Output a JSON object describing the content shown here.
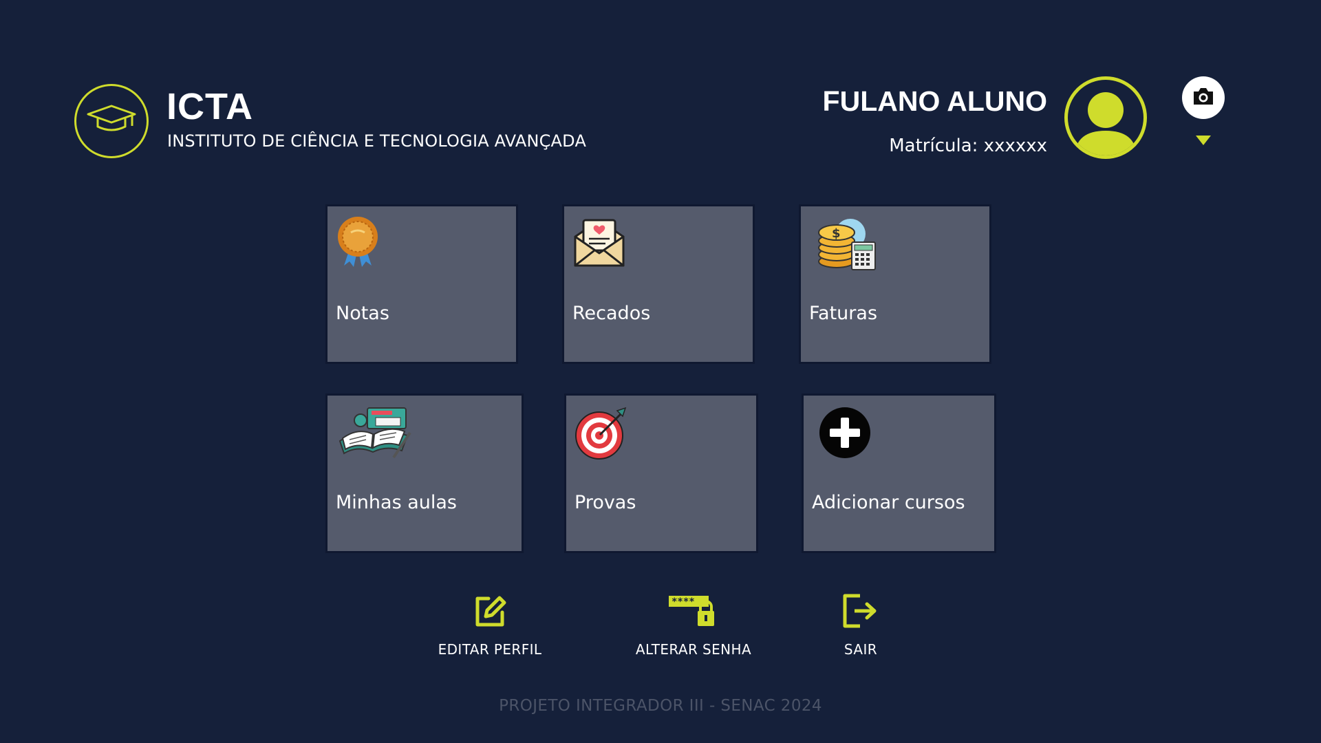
{
  "brand": {
    "title": "ICTA",
    "subtitle": "INSTITUTO DE CIÊNCIA E TECNOLOGIA AVANÇADA",
    "logo_icon": "graduation-cap-icon"
  },
  "user": {
    "name": "FULANO ALUNO",
    "matricula": "Matrícula: xxxxxx",
    "avatar_icon": "user-avatar-icon",
    "camera_icon": "camera-icon",
    "menu_icon": "chevron-down-icon"
  },
  "tiles": [
    {
      "label": "Notas",
      "icon": "medal-icon"
    },
    {
      "label": "Recados",
      "icon": "envelope-letter-icon"
    },
    {
      "label": "Faturas",
      "icon": "coins-calculator-icon"
    },
    {
      "label": "Minhas aulas",
      "icon": "open-book-icon"
    },
    {
      "label": "Provas",
      "icon": "target-arrow-icon"
    },
    {
      "label": "Adicionar cursos",
      "icon": "plus-circle-icon"
    }
  ],
  "actions": [
    {
      "label": "EDITAR PERFIL",
      "icon": "edit-icon"
    },
    {
      "label": "ALTERAR SENHA",
      "icon": "password-lock-icon"
    },
    {
      "label": "SAIR",
      "icon": "logout-icon"
    }
  ],
  "footer": "PROJETO INTEGRADOR III - SENAC 2024",
  "colors": {
    "background": "#15203a",
    "accent": "#cfdc2c",
    "tile": "#555b6c",
    "footer_text": "#4c5468"
  }
}
